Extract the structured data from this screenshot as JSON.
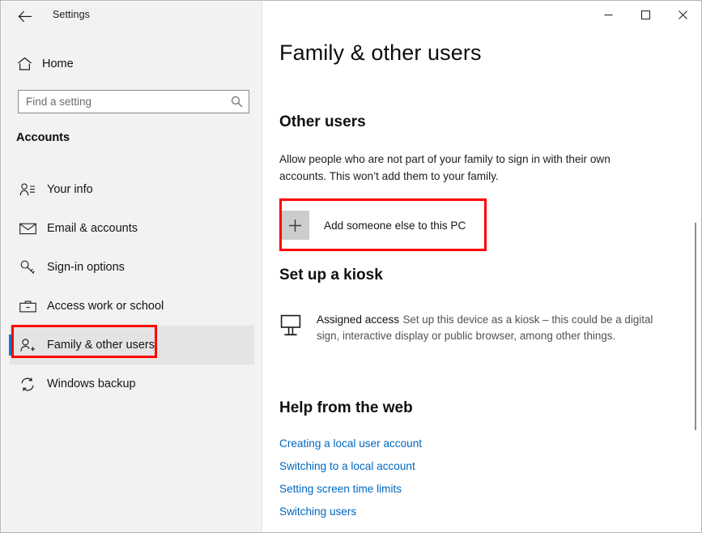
{
  "window": {
    "app_title": "Settings",
    "back_icon": "back-arrow-icon",
    "minimize_label": "—",
    "maximize_label": "□",
    "close_label": "✕"
  },
  "sidebar": {
    "home": {
      "label": "Home",
      "icon": "home-icon"
    },
    "search": {
      "value": "",
      "placeholder": "Find a setting",
      "icon": "search-icon"
    },
    "section_heading": "Accounts",
    "items": [
      {
        "label": "Your info",
        "icon": "user-info-icon",
        "selected": false
      },
      {
        "label": "Email & accounts",
        "icon": "envelope-icon",
        "selected": false
      },
      {
        "label": "Sign-in options",
        "icon": "key-icon",
        "selected": false
      },
      {
        "label": "Access work or school",
        "icon": "briefcase-icon",
        "selected": false
      },
      {
        "label": "Family & other users",
        "icon": "user-add-icon",
        "selected": true
      },
      {
        "label": "Windows backup",
        "icon": "sync-refresh-icon",
        "selected": false
      }
    ]
  },
  "main": {
    "page_title": "Family & other users",
    "other_users": {
      "heading": "Other users",
      "description": "Allow people who are not part of your family to sign in with their own accounts. This won’t add them to your family.",
      "add_user": {
        "label": "Add someone else to this PC",
        "icon": "plus-icon"
      }
    },
    "kiosk": {
      "heading": "Set up a kiosk",
      "item": {
        "title": "Assigned access",
        "description": "Set up this device as a kiosk – this could be a digital sign, interactive display or public browser, among other things.",
        "icon": "kiosk-display-icon"
      }
    },
    "help": {
      "heading": "Help from the web",
      "links": [
        "Creating a local user account",
        "Switching to a local account",
        "Setting screen time limits",
        "Switching users"
      ]
    }
  },
  "colors": {
    "accent": "#0078d4",
    "link": "#0067c0",
    "annotation": "#ff0000",
    "sidebar_bg": "#f2f2f2",
    "tile_bg": "#cccccc"
  }
}
